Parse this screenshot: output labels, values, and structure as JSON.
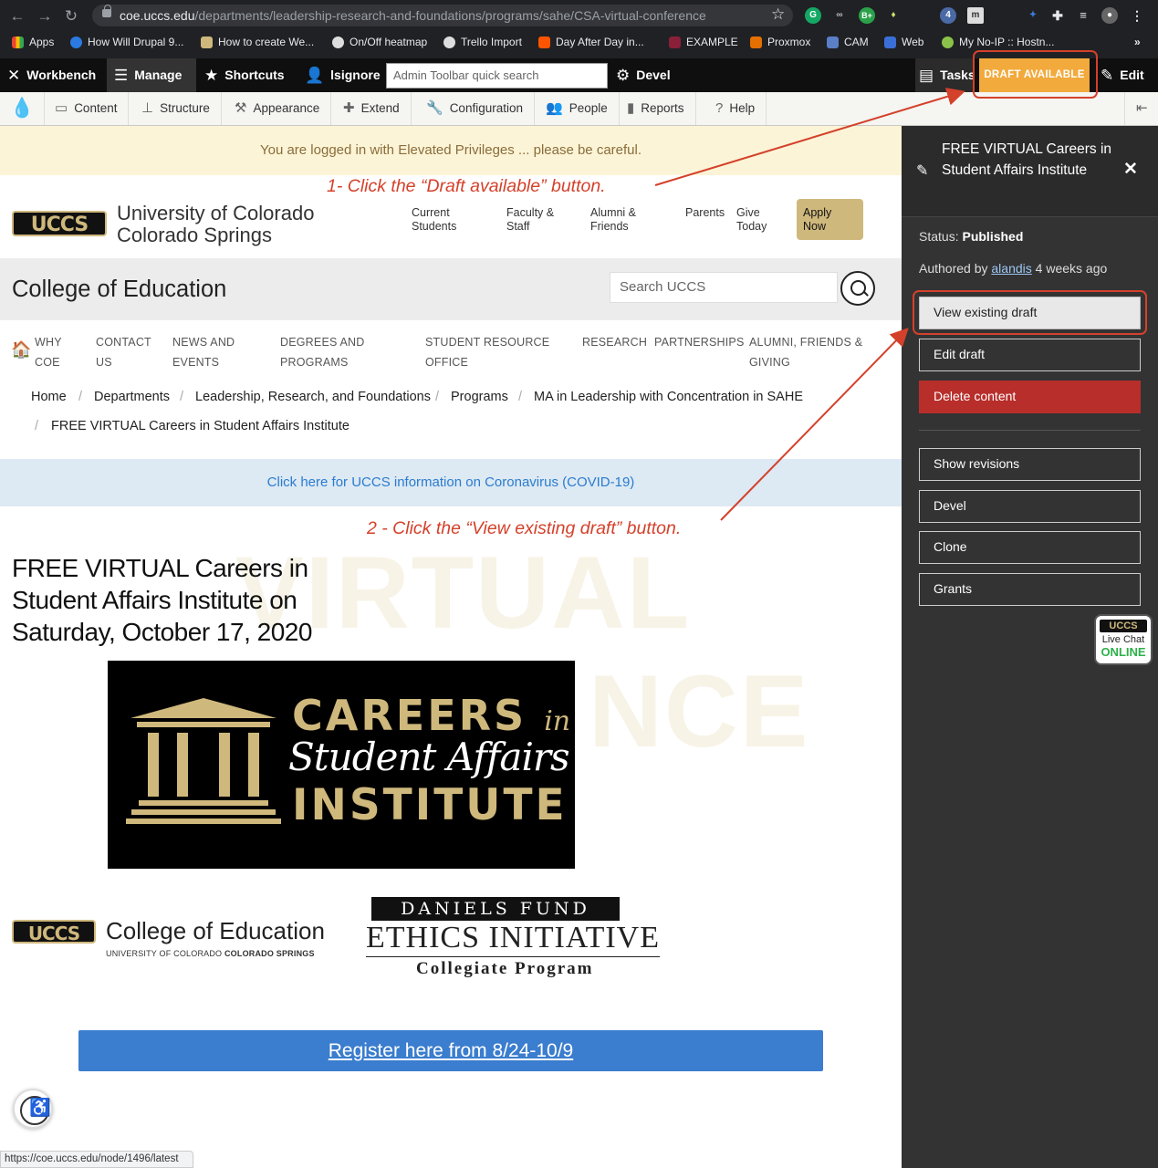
{
  "browser": {
    "url_host": "coe.uccs.edu",
    "url_path": "/departments/leadership-research-and-foundations/programs/sahe/CSA-virtual-conference",
    "bookmarks": [
      "Apps",
      "How Will Drupal 9...",
      "How to create We...",
      "On/Off heatmap",
      "Trello Import",
      "Day After Day in...",
      "EXAMPLE",
      "Proxmox",
      "CAM",
      "Web",
      "My No-IP :: Hostn..."
    ],
    "status_url": "https://coe.uccs.edu/node/1496/latest"
  },
  "toolbar": {
    "workbench": "Workbench",
    "manage": "Manage",
    "shortcuts": "Shortcuts",
    "user": "lsignore",
    "search_placeholder": "Admin Toolbar quick search",
    "devel": "Devel",
    "tasks": "Tasks",
    "draft_available": "DRAFT AVAILABLE",
    "edit": "Edit"
  },
  "admin_menu": [
    "Content",
    "Structure",
    "Appearance",
    "Extend",
    "Configuration",
    "People",
    "Reports",
    "Help"
  ],
  "page": {
    "warning": "You are logged in with Elevated Privileges ... please be careful.",
    "callout1": "1- Click the “Draft available” button.",
    "callout2": "2 - Click the “View existing draft” button.",
    "logo_text": "UCCS",
    "univ_line1": "University of Colorado",
    "univ_line2": "Colorado Springs",
    "header_nav": [
      {
        "l1": "Current",
        "l2": "Students"
      },
      {
        "l1": "Faculty &",
        "l2": "Staff"
      },
      {
        "l1": "Alumni &",
        "l2": "Friends"
      },
      {
        "l1": "Parents",
        "l2": ""
      },
      {
        "l1": "Give",
        "l2": "Today"
      }
    ],
    "apply_l1": "Apply",
    "apply_l2": "Now",
    "college_title": "College of Education",
    "search_placeholder": "Search UCCS",
    "main_nav": [
      {
        "l1": "WHY",
        "l2": "COE"
      },
      {
        "l1": "CONTACT",
        "l2": "US"
      },
      {
        "l1": "NEWS AND",
        "l2": "EVENTS"
      },
      {
        "l1": "DEGREES AND",
        "l2": "PROGRAMS"
      },
      {
        "l1": "STUDENT RESOURCE",
        "l2": "OFFICE"
      },
      {
        "l1": "RESEARCH",
        "l2": ""
      },
      {
        "l1": "PARTNERSHIPS",
        "l2": ""
      },
      {
        "l1": "ALUMNI, FRIENDS &",
        "l2": "GIVING"
      }
    ],
    "breadcrumbs": [
      "Home",
      "Departments",
      "Leadership, Research, and Foundations",
      "Programs",
      "MA in Leadership with Concentration in SAHE"
    ],
    "breadcrumb_current": "FREE VIRTUAL Careers in Student Affairs Institute",
    "covid_link": "Click here for UCCS information on Coronavirus (COVID-19)",
    "watermark1": "VIRTUAL",
    "watermark2": "NCE",
    "event_title": "FREE VIRTUAL Careers in Student Affairs Institute on Saturday, October 17, 2020",
    "banner_careers": "CAREERS",
    "banner_in": "in",
    "banner_student_affairs": "Student Affairs",
    "banner_institute": "INSTITUTE",
    "coe_logo_text": "College of Education",
    "coe_logo_sub_a": "UNIVERSITY OF COLORADO ",
    "coe_logo_sub_b": "COLORADO SPRINGS",
    "daniels_top": "DANIELS FUND",
    "daniels_mid": "ETHICS INITIATIVE",
    "daniels_bot": "Collegiate Program",
    "register_link": "Register here from 8/24-10/9"
  },
  "sidebar": {
    "title": "FREE VIRTUAL Careers in Student Affairs Institute",
    "status_label": "Status:",
    "status_value": "Published",
    "authored_prefix": "Authored by",
    "author": "alandis",
    "authored_suffix": "4 weeks ago",
    "buttons": {
      "view_draft": "View existing draft",
      "edit_draft": "Edit draft",
      "delete": "Delete content",
      "revisions": "Show revisions",
      "devel": "Devel",
      "clone": "Clone",
      "grants": "Grants"
    },
    "livechat_logo": "UCCS",
    "livechat_text": "Live Chat",
    "livechat_status": "ONLINE"
  }
}
